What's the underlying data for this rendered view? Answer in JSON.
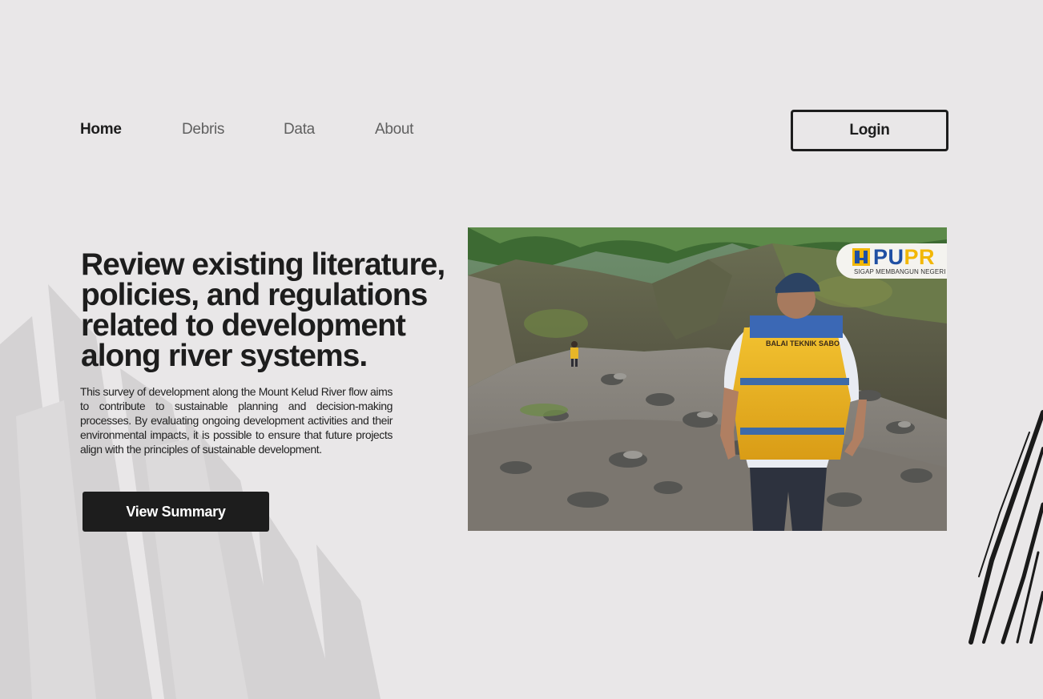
{
  "nav": {
    "items": [
      {
        "label": "Home",
        "active": true
      },
      {
        "label": "Debris",
        "active": false
      },
      {
        "label": "Data",
        "active": false
      },
      {
        "label": "About",
        "active": false
      }
    ],
    "login_label": "Login"
  },
  "hero": {
    "title": "Review existing literature, policies, and regulations related to development along river systems.",
    "description": "This survey of development along the Mount Kelud River flow aims to contribute to sustainable planning and decision-making processes. By evaluating ongoing development activities and their environmental impacts, it is possible to ensure that future projects align with the principles of sustainable development.",
    "cta_label": "View Summary"
  },
  "photo": {
    "logo": {
      "text_pu": "PU",
      "text_pr": "PR",
      "tagline": "SIGAP MEMBANGUN NEGERI"
    },
    "vest_text": "BALAI TEKNIK SABO"
  },
  "colors": {
    "background": "#e9e7e8",
    "text_dark": "#1d1d1d",
    "button_bg": "#1d1d1d",
    "pupr_blue": "#1f4fa3",
    "pupr_yellow": "#f2b705"
  }
}
